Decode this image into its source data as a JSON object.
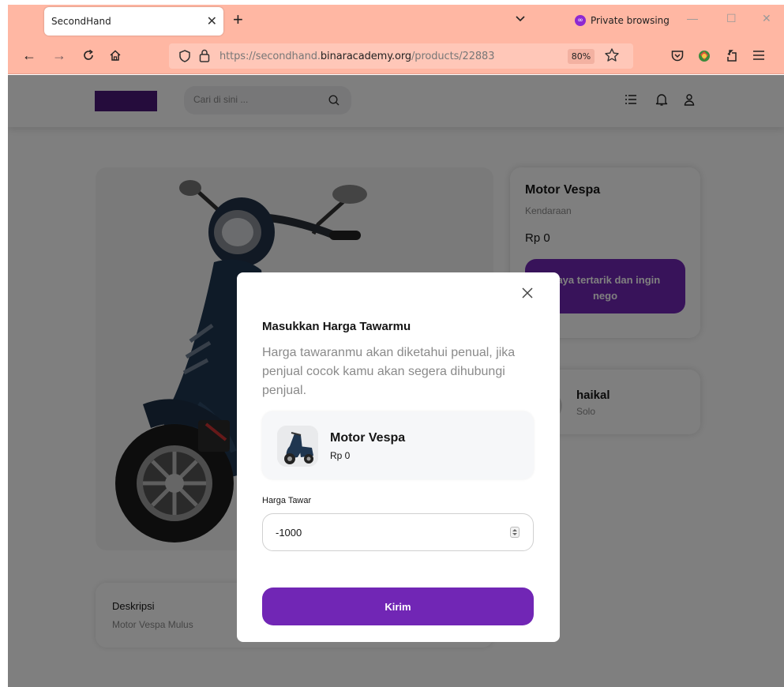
{
  "browser": {
    "tab_title": "SecondHand",
    "private_label": "Private browsing",
    "url_prefix": "https://secondhand.",
    "url_domain": "binaracademy.org",
    "url_path": "/products/22883",
    "zoom": "80%"
  },
  "header": {
    "search_placeholder": "Cari di sini ..."
  },
  "product": {
    "name": "Motor Vespa",
    "category": "Kendaraan",
    "price": "Rp 0",
    "nego_label": "Saya tertarik dan ingin nego",
    "description_title": "Deskripsi",
    "description": "Motor Vespa Mulus"
  },
  "seller": {
    "name": "haikal",
    "city": "Solo"
  },
  "modal": {
    "title": "Masukkan Harga Tawarmu",
    "description": "Harga tawaranmu akan diketahui penual, jika penjual cocok kamu akan segera dihubungi penjual.",
    "product_name": "Motor Vespa",
    "product_price": "Rp 0",
    "field_label": "Harga Tawar",
    "field_value": "-1000",
    "submit_label": "Kirim"
  },
  "colors": {
    "primary": "#7126b5",
    "tab_bar": "#ffb7a3"
  }
}
